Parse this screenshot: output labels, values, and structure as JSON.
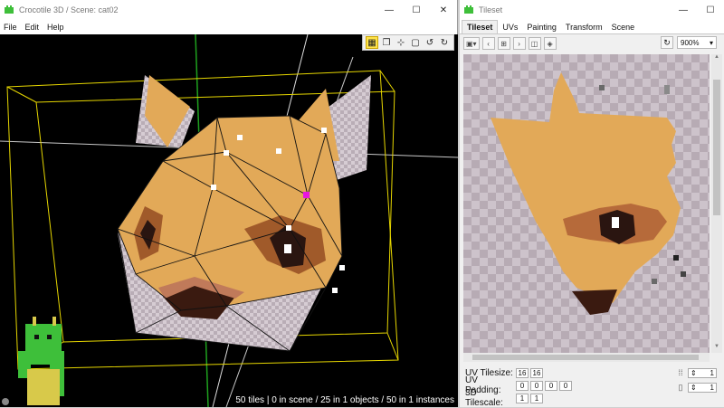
{
  "left_window": {
    "title": "Crocotile 3D / Scene: cat02",
    "menu": [
      "File",
      "Edit",
      "Help"
    ],
    "status": "50 tiles | 0 in scene / 25 in 1 objects / 50 in 1 instances"
  },
  "right_window": {
    "title": "Tileset",
    "tabs": [
      "Tileset",
      "UVs",
      "Painting",
      "Transform",
      "Scene"
    ],
    "active_tab": "Tileset",
    "zoom": "900%",
    "uv_tilesize": {
      "label": "UV Tilesize:",
      "values": [
        "16",
        "16"
      ]
    },
    "uv_padding": {
      "label": "UV Padding:",
      "values": [
        "0",
        "0",
        "0",
        "0"
      ]
    },
    "tilescale_3d": {
      "label": "3D Tilescale:",
      "values": [
        "1",
        "1"
      ]
    },
    "spin_top": "1",
    "spin_bottom": "1"
  },
  "window_buttons": {
    "minimize": "—",
    "maximize": "☐",
    "close": "✕"
  },
  "colors": {
    "fur": "#e2a958",
    "dark_fur": "#5a2c1a",
    "outline_yellow": "#e6d600",
    "axis_green": "#1ea11e",
    "selection_magenta": "#e815e0",
    "croc_green": "#3ebf3a"
  }
}
